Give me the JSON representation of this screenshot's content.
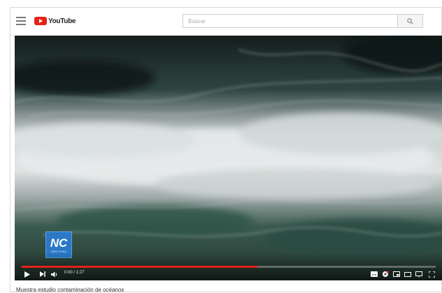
{
  "app": {
    "logo_text": "YouTube"
  },
  "search": {
    "placeholder": "Buscar"
  },
  "player": {
    "time_display": "0:00 / 1:27",
    "progress_fraction": 0.57,
    "channel_logo": {
      "mark": "NC",
      "subtitle": "NEW CHINA"
    }
  },
  "video": {
    "title": "Muestra estudio contaminación de océanos"
  },
  "colors": {
    "accent": "#e62117",
    "channel_blue": "#2a78c6"
  },
  "icons": [
    "menu-icon",
    "search-icon",
    "play-icon",
    "next-icon",
    "volume-icon",
    "subtitles-icon",
    "settings-icon",
    "miniplayer-icon",
    "theater-icon",
    "cast-icon",
    "fullscreen-icon"
  ]
}
